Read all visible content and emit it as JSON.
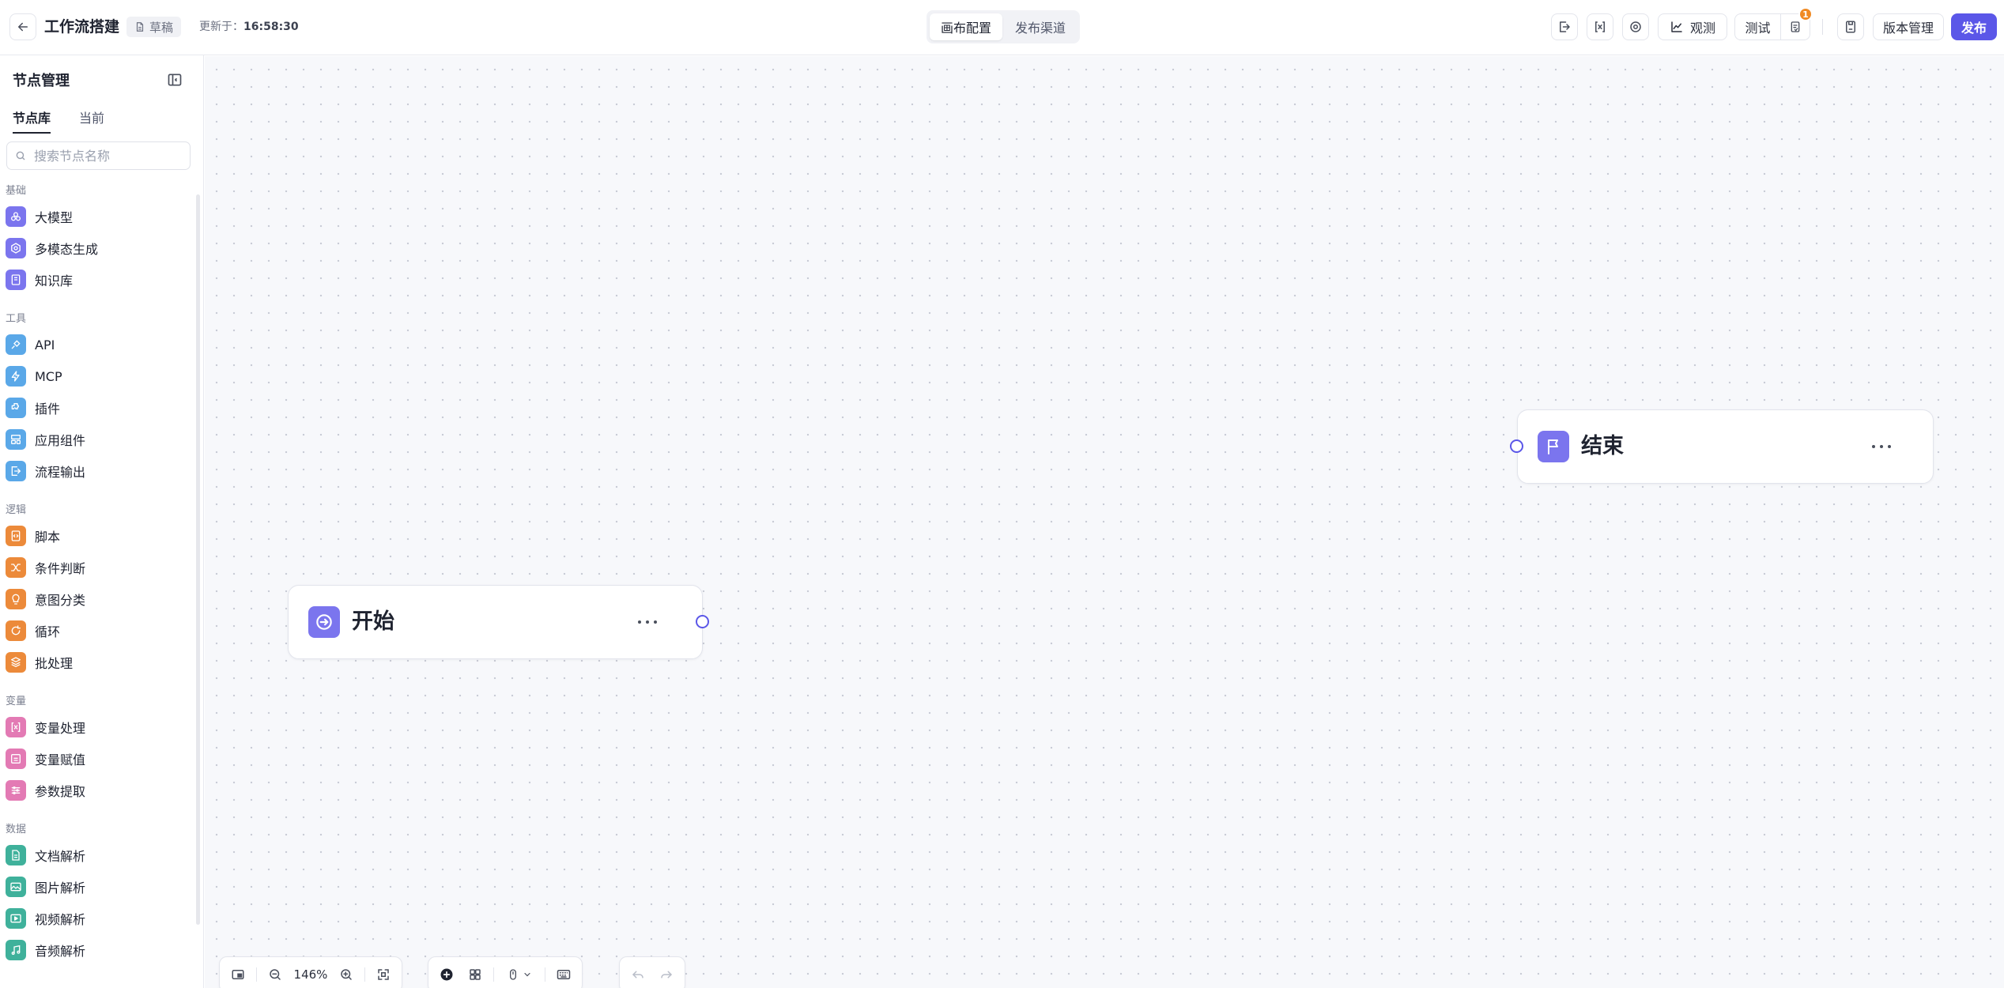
{
  "header": {
    "app_title": "工作流搭建",
    "draft_label": "草稿",
    "updated_prefix": "更新于：",
    "updated_time": "16:58:30",
    "tabs": [
      {
        "label": "画布配置",
        "active": true
      },
      {
        "label": "发布渠道",
        "active": false
      }
    ],
    "observe_label": "观测",
    "test_label": "测试",
    "notification_count": "1",
    "version_label": "版本管理",
    "publish_label": "发布"
  },
  "sidebar": {
    "title": "节点管理",
    "tabs": [
      {
        "label": "节点库",
        "active": true
      },
      {
        "label": "当前",
        "active": false
      }
    ],
    "search_placeholder": "搜索节点名称",
    "sections": [
      {
        "label": "基础",
        "items": [
          {
            "label": "大模型",
            "icon": "llm-icon",
            "color": "#7b75ee"
          },
          {
            "label": "多模态生成",
            "icon": "multimodal-icon",
            "color": "#7b75ee"
          },
          {
            "label": "知识库",
            "icon": "knowledge-base-icon",
            "color": "#7b75ee"
          }
        ]
      },
      {
        "label": "工具",
        "items": [
          {
            "label": "API",
            "icon": "api-icon",
            "color": "#5aa8e8"
          },
          {
            "label": "MCP",
            "icon": "mcp-icon",
            "color": "#5aa8e8"
          },
          {
            "label": "插件",
            "icon": "plugin-icon",
            "color": "#5aa8e8"
          },
          {
            "label": "应用组件",
            "icon": "app-component-icon",
            "color": "#5aa8e8"
          },
          {
            "label": "流程输出",
            "icon": "flow-output-icon",
            "color": "#5aa8e8"
          }
        ]
      },
      {
        "label": "逻辑",
        "items": [
          {
            "label": "脚本",
            "icon": "script-icon",
            "color": "#ec8a3a"
          },
          {
            "label": "条件判断",
            "icon": "condition-icon",
            "color": "#ec8a3a"
          },
          {
            "label": "意图分类",
            "icon": "intent-icon",
            "color": "#ec8a3a"
          },
          {
            "label": "循环",
            "icon": "loop-icon",
            "color": "#ec8a3a"
          },
          {
            "label": "批处理",
            "icon": "batch-icon",
            "color": "#ec8a3a"
          }
        ]
      },
      {
        "label": "变量",
        "items": [
          {
            "label": "变量处理",
            "icon": "variable-process-icon",
            "color": "#e37ab4"
          },
          {
            "label": "变量赋值",
            "icon": "variable-assign-icon",
            "color": "#e37ab4"
          },
          {
            "label": "参数提取",
            "icon": "param-extract-icon",
            "color": "#e37ab4"
          }
        ]
      },
      {
        "label": "数据",
        "items": [
          {
            "label": "文档解析",
            "icon": "doc-parse-icon",
            "color": "#3fb19b"
          },
          {
            "label": "图片解析",
            "icon": "image-parse-icon",
            "color": "#3fb19b"
          },
          {
            "label": "视频解析",
            "icon": "video-parse-icon",
            "color": "#3fb19b"
          },
          {
            "label": "音频解析",
            "icon": "audio-parse-icon",
            "color": "#3fb19b"
          }
        ]
      }
    ]
  },
  "canvas": {
    "nodes": [
      {
        "label": "开始",
        "icon": "start-arrow-icon"
      },
      {
        "label": "结束",
        "icon": "flag-icon"
      }
    ]
  },
  "bottom_toolbar": {
    "zoom": "146%"
  },
  "colors": {
    "accent": "#5b57e8",
    "node_icon": "#7b75ee",
    "badge": "#f08a24"
  }
}
